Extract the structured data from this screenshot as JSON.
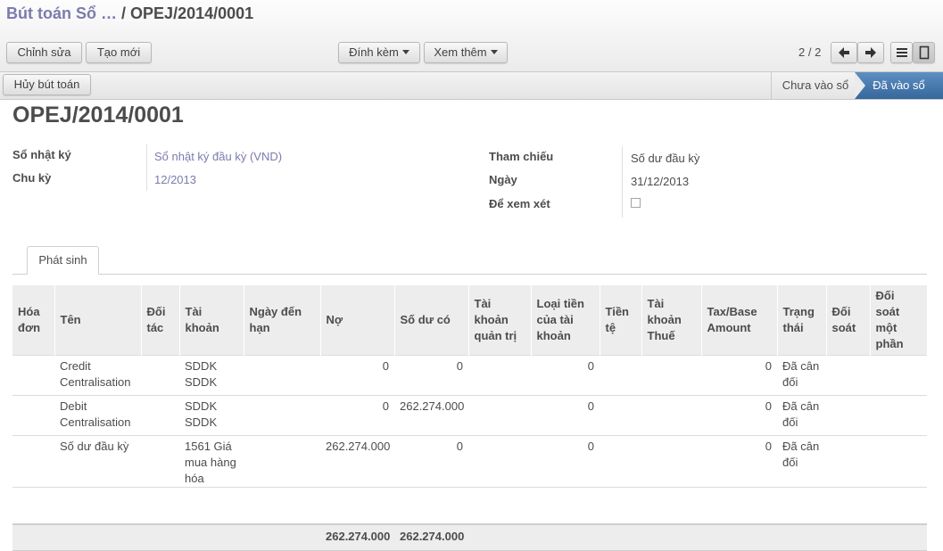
{
  "breadcrumb": {
    "parent": "Bút toán Sổ …",
    "separator": "/",
    "current": "OPEJ/2014/0001"
  },
  "toolbar": {
    "edit_label": "Chỉnh sửa",
    "create_label": "Tạo mới",
    "attach_label": "Đính kèm",
    "more_label": "Xem thêm"
  },
  "pager": {
    "text": "2 / 2"
  },
  "action": {
    "cancel_label": "Hủy bút toán"
  },
  "status": {
    "stages": [
      "Chưa vào sổ",
      "Đã vào sổ"
    ],
    "active": "Đã vào sổ"
  },
  "record": {
    "title": "OPEJ/2014/0001",
    "fields": {
      "journal_label": "Sổ nhật ký",
      "journal_value": "Sổ nhật ký đầu kỳ (VND)",
      "period_label": "Chu kỳ",
      "period_value": "12/2013",
      "ref_label": "Tham chiếu",
      "ref_value": "Số dư đầu kỳ",
      "date_label": "Ngày",
      "date_value": "31/12/2013",
      "review_label": "Để xem xét",
      "review_checked": false
    }
  },
  "tabs": [
    "Phát sinh"
  ],
  "table": {
    "headers": [
      "Hóa đơn",
      "Tên",
      "Đối tác",
      "Tài khoản",
      "Ngày đến hạn",
      "Nợ",
      "Số dư có",
      "Tài khoản quản trị",
      "Loại tiền của tài khoản",
      "Tiền tệ",
      "Tài khoản Thuế",
      "Tax/Base Amount",
      "Trạng thái",
      "Đối soát",
      "Đối soát một phần"
    ],
    "rows": [
      [
        "",
        "Credit Centralisation",
        "",
        "SDDK SDDK",
        "",
        "0",
        "0",
        "",
        "0",
        "",
        "",
        "0",
        "Đã cân đối",
        "",
        ""
      ],
      [
        "",
        "Debit Centralisation",
        "",
        "SDDK SDDK",
        "",
        "0",
        "262.274.000",
        "",
        "0",
        "",
        "",
        "0",
        "Đã cân đối",
        "",
        ""
      ],
      [
        "",
        "Số dư đầu kỳ",
        "",
        "1561 Giá mua hàng hóa",
        "",
        "262.274.000",
        "0",
        "",
        "0",
        "",
        "",
        "0",
        "Đã cân đối",
        "",
        ""
      ]
    ],
    "totals": {
      "debit": "262.274.000",
      "credit": "262.274.000"
    }
  },
  "colors": {
    "link": "#7c7bad",
    "active_stage": "#4a7bb0"
  },
  "icons": {
    "prev": "arrow-left-icon",
    "next": "arrow-right-icon",
    "list": "list-view-icon",
    "form": "form-view-icon"
  }
}
